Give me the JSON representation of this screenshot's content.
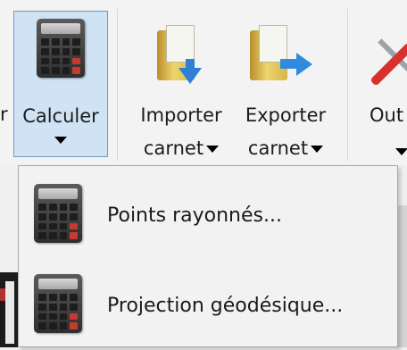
{
  "ribbon": {
    "calculer": {
      "label": "Calculer",
      "icon": "calculator-icon"
    },
    "importer": {
      "label_line1": "Importer",
      "label_line2": "carnet",
      "icon": "folder-import-icon"
    },
    "exporter": {
      "label_line1": "Exporter",
      "label_line2": "carnet",
      "icon": "folder-export-icon"
    },
    "outils": {
      "label": "Out",
      "icon": "tools-icon"
    }
  },
  "menu": {
    "items": [
      {
        "label": "Points rayonnés...",
        "icon": "calculator-icon"
      },
      {
        "label": "Projection géodésique...",
        "icon": "calculator-icon"
      }
    ]
  },
  "colors": {
    "selected_bg": "#cfe3f5",
    "selected_border": "#6c9bc6",
    "arrow_blue": "#2f7fd4"
  }
}
